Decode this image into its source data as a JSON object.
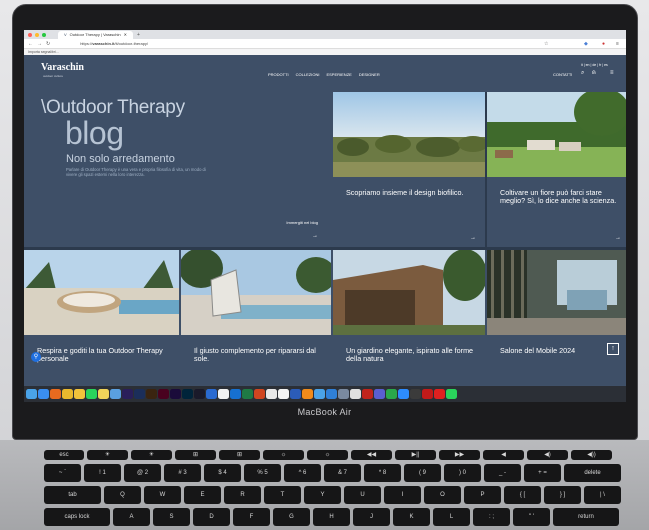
{
  "browser": {
    "tab_title": "Outdoor Therapy | Varaschin",
    "url_prefix": "https://",
    "url_domain": "varaschin.it",
    "url_path": "/it/outdoor-therapy/",
    "bookmark": "Importa segnalibri..."
  },
  "site": {
    "logo": "Varaschin",
    "logo_sub": "outdoor culture",
    "nav": [
      "PRODOTTI",
      "COLLEZIONI",
      "ESPERIENZE",
      "DESIGNER"
    ],
    "contact": "CONTATTI",
    "languages": "it | en | de | fr | es",
    "hero": {
      "title": "\\Outdoor Therapy",
      "subtitle": "blog",
      "tagline": "Non solo arredamento",
      "description": "Parlare di Outdoor Therapy è una vera e propria filosofia di vita, un modo di vivere gli spazi esterni nella loro interezza.",
      "cta": "Immergiti nel blog"
    },
    "cards_top": [
      {
        "caption": "Scopriamo insieme il design biofilico."
      },
      {
        "caption": "Coltivare un fiore può farci stare meglio? Sì, lo dice anche la scienza."
      }
    ],
    "cards_bottom": [
      {
        "caption": "Respira e goditi la tua Outdoor Therapy personale"
      },
      {
        "caption": "Il giusto complemento per ripararsi dal sole."
      },
      {
        "caption": "Un giardino elegante, ispirato alle forme della natura"
      },
      {
        "caption": "Salone del Mobile 2024"
      }
    ]
  },
  "dock": {
    "icons": [
      "finder-icon",
      "safari-icon",
      "firefox-icon",
      "chrome-icon",
      "photos-icon",
      "spotify-icon",
      "notes-icon",
      "files-icon",
      "after-effects-icon",
      "photoshop-icon",
      "illustrator-icon",
      "indesign-icon",
      "media-encoder-icon",
      "audition-icon",
      "bridge-icon",
      "app-icon",
      "chrome-icon",
      "outlook-icon",
      "excel-icon",
      "powerpoint-icon",
      "preview-icon",
      "calendar-icon",
      "word-icon",
      "vlc-icon",
      "finder-icon",
      "app-icon",
      "app-icon",
      "notes-icon",
      "filezilla-icon",
      "teams-icon",
      "messages-icon",
      "zoom-icon",
      "app-icon",
      "acrobat-icon",
      "acrobat-reader-icon",
      "whatsapp-icon"
    ],
    "colors": [
      "#4aa3e8",
      "#3a8ef0",
      "#e86a1f",
      "#e9b92e",
      "#f2c33b",
      "#2ad35c",
      "#f1d45a",
      "#5aa0e0",
      "#2a1e5a",
      "#1b2e5a",
      "#3a2410",
      "#49021f",
      "#1a0b3a",
      "#00243a",
      "#1a1a2a",
      "#2a6ad0",
      "#f2f2f2",
      "#1670d0",
      "#1f7a45",
      "#d04520",
      "#e8e8e8",
      "#f4f4f4",
      "#2b5cb8",
      "#ef8a1b",
      "#4aa3e8",
      "#2f80d8",
      "#7a8aa0",
      "#e0e0e0",
      "#c0241c",
      "#5a5ed0",
      "#2aa84a",
      "#2d8cff",
      "#3b3b3b",
      "#c21a1a",
      "#e02020",
      "#2ad35c"
    ]
  },
  "laptop": {
    "brand": "MacBook Air"
  },
  "keyboard": {
    "row1": [
      "esc",
      "☀",
      "☀",
      "⊞",
      "⊞",
      "☼",
      "☼",
      "◀◀",
      "▶||",
      "▶▶",
      "◀",
      "◀)",
      "◀))"
    ],
    "row2": [
      "~ `",
      "! 1",
      "@ 2",
      "# 3",
      "$ 4",
      "% 5",
      "^ 6",
      "& 7",
      "* 8",
      "( 9",
      ") 0",
      "_ -",
      "+ =",
      "delete"
    ],
    "row3": [
      "tab",
      "Q",
      "W",
      "E",
      "R",
      "T",
      "Y",
      "U",
      "I",
      "O",
      "P",
      "{ [",
      "} ]",
      "| \\"
    ],
    "row4": [
      "caps lock",
      "A",
      "S",
      "D",
      "F",
      "G",
      "H",
      "J",
      "K",
      "L",
      ": ;",
      "\" '",
      "return"
    ]
  }
}
